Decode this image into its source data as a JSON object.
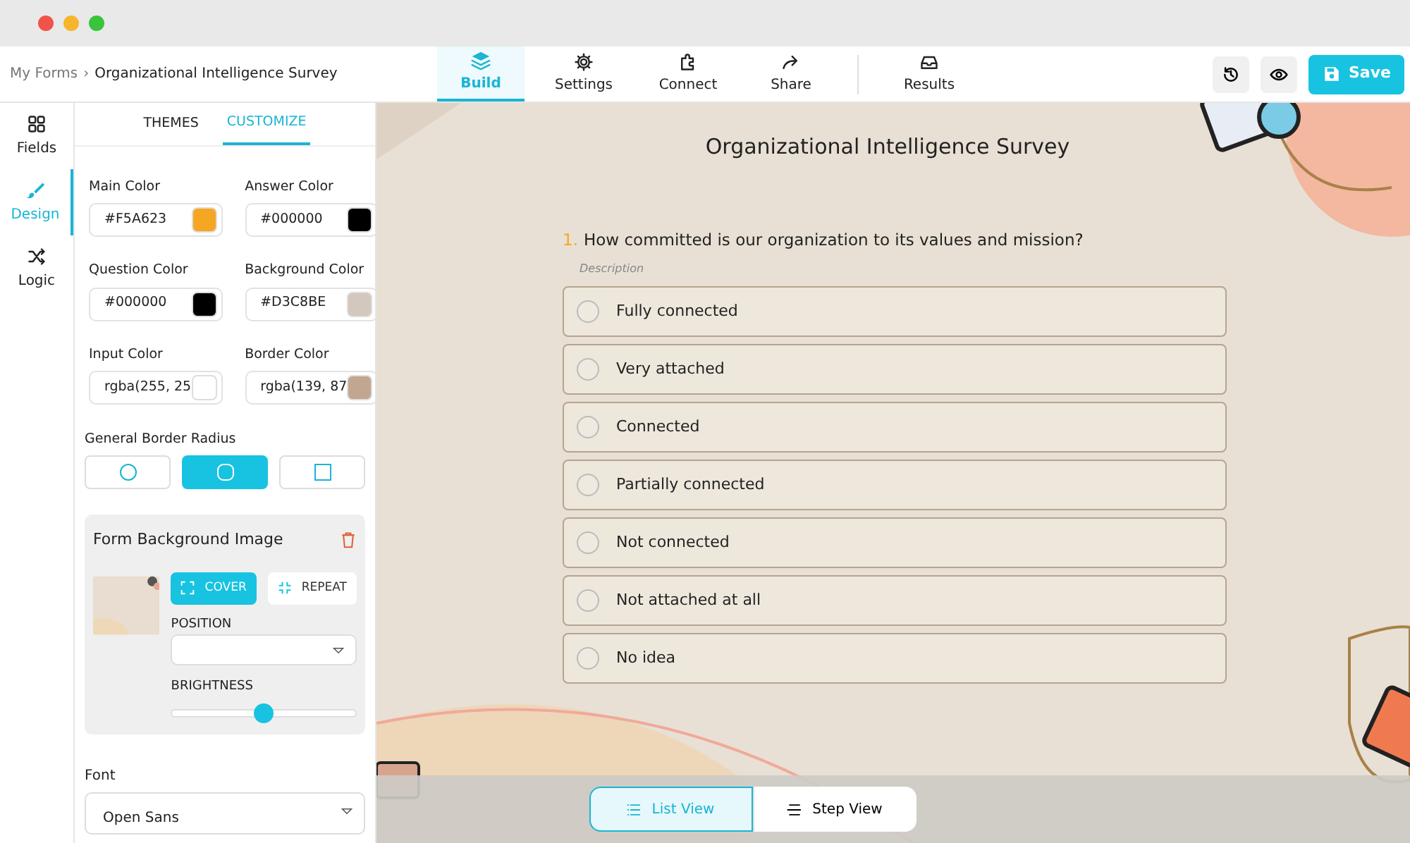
{
  "breadcrumb": {
    "parent": "My Forms",
    "separator": "›",
    "current": "Organizational Intelligence Survey"
  },
  "nav_tabs": [
    {
      "label": "Build",
      "kind": "layers",
      "selected": true
    },
    {
      "label": "Settings",
      "kind": "gear",
      "selected": false
    },
    {
      "label": "Connect",
      "kind": "puzzle",
      "selected": false
    },
    {
      "label": "Share",
      "kind": "share",
      "selected": false
    },
    {
      "label": "Results",
      "kind": "inbox",
      "selected": false
    }
  ],
  "save_button": {
    "label": "Save"
  },
  "rail": [
    {
      "label": "Fields",
      "kind": "grid",
      "selected": false
    },
    {
      "label": "Design",
      "kind": "brush",
      "selected": true
    },
    {
      "label": "Logic",
      "kind": "shuffle",
      "selected": false
    }
  ],
  "panel_tabs": [
    {
      "label": "THEMES",
      "selected": false
    },
    {
      "label": "CUSTOMIZE",
      "selected": true
    }
  ],
  "colors": [
    {
      "label": "Main Color",
      "value": "#F5A623",
      "color": "#f5a623"
    },
    {
      "label": "Answer Color",
      "value": "#000000",
      "color": "#000000"
    },
    {
      "label": "Question Color",
      "value": "#000000",
      "color": "#000000"
    },
    {
      "label": "Background Color",
      "value": "#D3C8BE",
      "color": "#d3c8be"
    },
    {
      "label": "Input Color",
      "value": "rgba(255, 25",
      "color": "#ffffff"
    },
    {
      "label": "Border Color",
      "value": "rgba(139, 87",
      "color": "#c2a690"
    }
  ],
  "border_radius": {
    "label": "General Border Radius",
    "options": [
      {
        "kind": "circle",
        "selected": false
      },
      {
        "kind": "rounded",
        "selected": true
      },
      {
        "kind": "square",
        "selected": false
      }
    ]
  },
  "background_image": {
    "title": "Form Background Image",
    "fit_options": [
      {
        "label": "COVER",
        "kind": "cover",
        "selected": true
      },
      {
        "label": "REPEAT",
        "kind": "repeat",
        "selected": false
      }
    ],
    "position_label": "POSITION",
    "brightness_label": "BRIGHTNESS",
    "level": 0.5
  },
  "font": {
    "label": "Font",
    "value": "Open Sans"
  },
  "form": {
    "title": "Organizational Intelligence Survey",
    "question": {
      "number": "1.",
      "text": "How committed is our organization to its values and mission?",
      "description": "Description",
      "options": [
        {
          "label": "Fully connected",
          "selected": false
        },
        {
          "label": "Very attached",
          "selected": false
        },
        {
          "label": "Connected",
          "selected": false
        },
        {
          "label": "Partially connected",
          "selected": false
        },
        {
          "label": "Not connected",
          "selected": false
        },
        {
          "label": "Not attached at all",
          "selected": false
        },
        {
          "label": "No idea",
          "selected": false
        }
      ]
    }
  },
  "view_toggle": [
    {
      "label": "List View",
      "kind": "list",
      "selected": true
    },
    {
      "label": "Step View",
      "kind": "step",
      "selected": false
    }
  ]
}
